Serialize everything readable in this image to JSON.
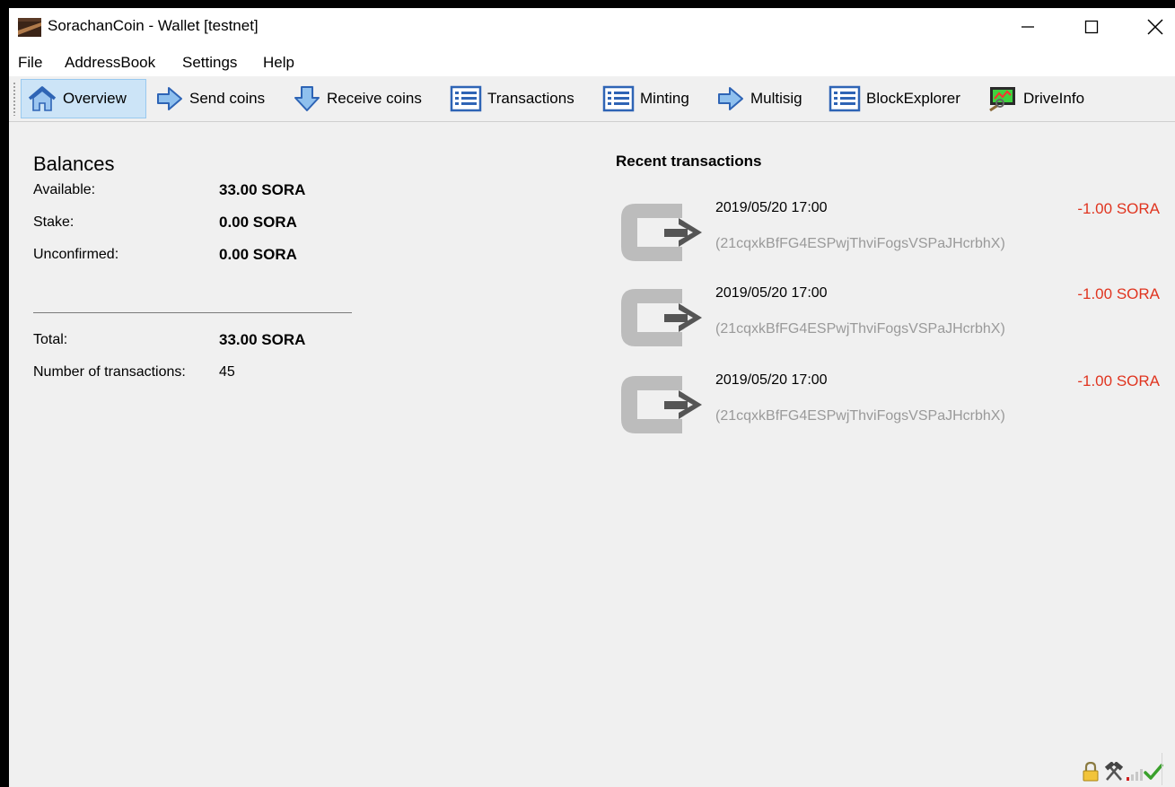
{
  "window": {
    "title": "SorachanCoin - Wallet [testnet]"
  },
  "menu": [
    "File",
    "AddressBook",
    "Settings",
    "Help"
  ],
  "toolbar": [
    {
      "label": "Overview",
      "icon": "home-icon",
      "active": true
    },
    {
      "label": "Send coins",
      "icon": "arrow-right-icon"
    },
    {
      "label": "Receive coins",
      "icon": "arrow-down-icon"
    },
    {
      "label": "Transactions",
      "icon": "list-icon"
    },
    {
      "label": "Minting",
      "icon": "list-icon"
    },
    {
      "label": "Multisig",
      "icon": "arrow-right-icon"
    },
    {
      "label": "BlockExplorer",
      "icon": "list-icon"
    },
    {
      "label": "DriveInfo",
      "icon": "drive-info-icon"
    }
  ],
  "balances": {
    "heading": "Balances",
    "available_label": "Available:",
    "available_value": "33.00 SORA",
    "stake_label": "Stake:",
    "stake_value": "0.00 SORA",
    "unconfirmed_label": "Unconfirmed:",
    "unconfirmed_value": "0.00 SORA",
    "total_label": "Total:",
    "total_value": "33.00 SORA",
    "txcount_label": "Number of transactions:",
    "txcount_value": "45"
  },
  "recent": {
    "heading": "Recent transactions",
    "items": [
      {
        "date": "2019/05/20 17:00",
        "amount": "-1.00 SORA",
        "address": "(21cqxkBfFG4ESPwjThviFogsVSPaJHcrbhX)"
      },
      {
        "date": "2019/05/20 17:00",
        "amount": "-1.00 SORA",
        "address": "(21cqxkBfFG4ESPwjThviFogsVSPaJHcrbhX)"
      },
      {
        "date": "2019/05/20 17:00",
        "amount": "-1.00 SORA",
        "address": "(21cqxkBfFG4ESPwjThviFogsVSPaJHcrbhX)"
      }
    ]
  },
  "colors": {
    "negative_amount": "#e0341f",
    "address": "#9a9a9a",
    "active_tab_bg": "#cce4f7"
  },
  "status_icons": [
    "lock-icon",
    "hammer-icon",
    "signal-icon",
    "check-icon"
  ]
}
